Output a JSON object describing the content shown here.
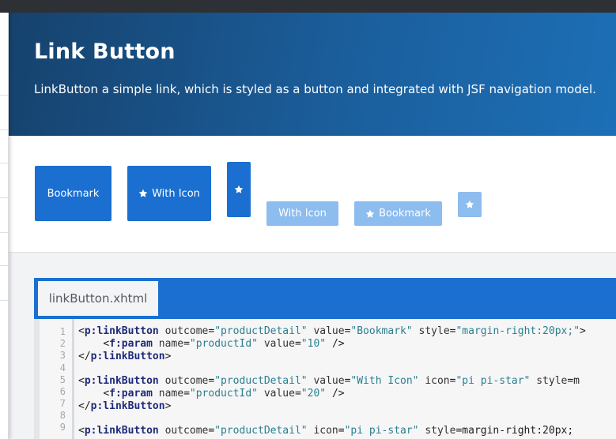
{
  "header": {
    "title": "Link Button",
    "description": "LinkButton a simple link, which is styled as a button and integrated with JSF navigation model."
  },
  "demo": {
    "buttons": [
      {
        "label": "Bookmark",
        "icon": null,
        "state": "enabled"
      },
      {
        "label": "With Icon",
        "icon": "star-icon",
        "state": "enabled"
      },
      {
        "label": "",
        "icon": "star-icon",
        "state": "enabled"
      },
      {
        "label": "With Icon",
        "icon": null,
        "state": "disabled"
      },
      {
        "label": "Bookmark",
        "icon": "star-icon",
        "state": "disabled"
      },
      {
        "label": "",
        "icon": "star-icon",
        "state": "disabled"
      }
    ]
  },
  "code": {
    "tab_label": "linkButton.xhtml",
    "line_numbers": [
      "1",
      "2",
      "3",
      "4",
      "5",
      "6",
      "7",
      "8",
      "9"
    ],
    "lines": [
      {
        "number": "1",
        "text": "<p:linkButton outcome=\"productDetail\" value=\"Bookmark\" style=\"margin-right:20px;\">"
      },
      {
        "number": "2",
        "text": "    <f:param name=\"productId\" value=\"10\" />"
      },
      {
        "number": "3",
        "text": "</p:linkButton>"
      },
      {
        "number": "4",
        "text": ""
      },
      {
        "number": "5",
        "text": "<p:linkButton outcome=\"productDetail\" value=\"With Icon\" icon=\"pi pi-star\" style=\"m"
      },
      {
        "number": "6",
        "text": "    <f:param name=\"productId\" value=\"20\" />"
      },
      {
        "number": "7",
        "text": "</p:linkButton>"
      },
      {
        "number": "8",
        "text": ""
      },
      {
        "number": "9",
        "text": "<p:linkButton outcome=\"productDetail\" icon=\"pi pi-star\" style=\"margin-right:20px;"
      }
    ]
  },
  "colors": {
    "accent": "#1a6fd0",
    "accent_disabled": "#8dbcee",
    "header_start": "#16426d",
    "header_end": "#1c6fb6"
  }
}
